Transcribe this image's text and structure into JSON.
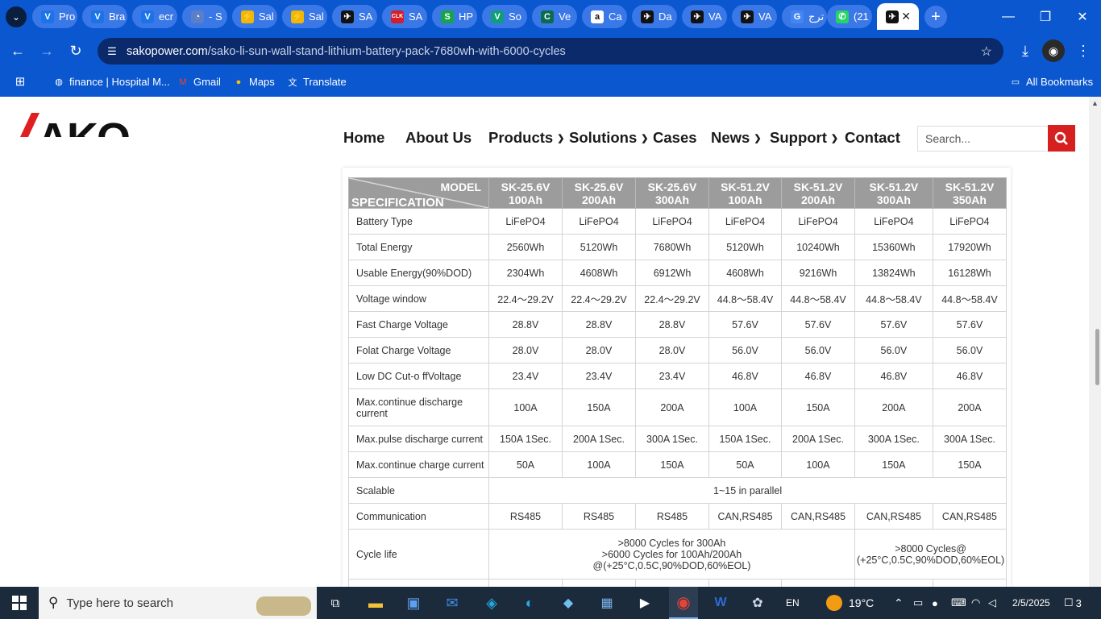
{
  "browser": {
    "tabs": [
      {
        "label": "Pro",
        "fav": "V",
        "favbg": "#1a73e8"
      },
      {
        "label": "Bra",
        "fav": "V",
        "favbg": "#1a73e8"
      },
      {
        "label": "ecr",
        "fav": "V",
        "favbg": "#1a73e8"
      },
      {
        "label": "- S",
        "fav": "◔",
        "favbg": "#5b7fc7"
      },
      {
        "label": "Sal",
        "fav": "⚡",
        "favbg": "#f2b705"
      },
      {
        "label": "Sal",
        "fav": "⚡",
        "favbg": "#f2b705"
      },
      {
        "label": "SA",
        "fav": "✈",
        "favbg": "#111111"
      },
      {
        "label": "SA",
        "fav": "CLK",
        "favbg": "#d21f2b"
      },
      {
        "label": "HP",
        "fav": "S",
        "favbg": "#16a34a"
      },
      {
        "label": "So",
        "fav": "V",
        "favbg": "#0f9d7a"
      },
      {
        "label": "Ve",
        "fav": "C",
        "favbg": "#0b6b4f"
      },
      {
        "label": "Ca",
        "fav": "a",
        "favbg": "#ffffff"
      },
      {
        "label": "Da",
        "fav": "✈",
        "favbg": "#111111"
      },
      {
        "label": "VA",
        "fav": "✈",
        "favbg": "#111111"
      },
      {
        "label": "VA",
        "fav": "✈",
        "favbg": "#111111"
      },
      {
        "label": "ترج",
        "fav": "G",
        "favbg": "#4285f4"
      },
      {
        "label": "(21",
        "fav": "✆",
        "favbg": "#25d366"
      }
    ],
    "active_tab": {
      "fav": "✈"
    },
    "url_domain": "sakopower.com",
    "url_path": "/sako-li-sun-wall-stand-lithium-battery-pack-7680wh-with-6000-cycles",
    "bookmarks": [
      "finance | Hospital M...",
      "Gmail",
      "Maps",
      "Translate"
    ],
    "all_bookmarks": "All Bookmarks"
  },
  "site": {
    "logo": "AKO",
    "nav": [
      "Home",
      "About Us",
      "Products",
      "Solutions",
      "Cases",
      "News",
      "Support",
      "Contact"
    ],
    "search_placeholder": "Search..."
  },
  "spec_table": {
    "corner_top": "MODEL",
    "corner_bottom": "SPECIFICATION",
    "models": [
      [
        "SK-25.6V",
        "100Ah"
      ],
      [
        "SK-25.6V",
        "200Ah"
      ],
      [
        "SK-25.6V",
        "300Ah"
      ],
      [
        "SK-51.2V",
        "100Ah"
      ],
      [
        "SK-51.2V",
        "200Ah"
      ],
      [
        "SK-51.2V",
        "300Ah"
      ],
      [
        "SK-51.2V",
        "350Ah"
      ]
    ],
    "rows": [
      {
        "label": "Battery Type",
        "cells": [
          "LiFePO4",
          "LiFePO4",
          "LiFePO4",
          "LiFePO4",
          "LiFePO4",
          "LiFePO4",
          "LiFePO4"
        ]
      },
      {
        "label": "Total Energy",
        "cells": [
          "2560Wh",
          "5120Wh",
          "7680Wh",
          "5120Wh",
          "10240Wh",
          "15360Wh",
          "17920Wh"
        ]
      },
      {
        "label": "Usable Energy(90%DOD)",
        "cells": [
          "2304Wh",
          "4608Wh",
          "6912Wh",
          "4608Wh",
          "9216Wh",
          "13824Wh",
          "16128Wh"
        ]
      },
      {
        "label": "Voltage window",
        "cells": [
          "22.4～29.2V",
          "22.4～29.2V",
          "22.4～29.2V",
          "44.8～58.4V",
          "44.8～58.4V",
          "44.8～58.4V",
          "44.8～58.4V"
        ]
      },
      {
        "label": "Fast Charge Voltage",
        "cells": [
          "28.8V",
          "28.8V",
          "28.8V",
          "57.6V",
          "57.6V",
          "57.6V",
          "57.6V"
        ]
      },
      {
        "label": "Folat Charge Voltage",
        "cells": [
          "28.0V",
          "28.0V",
          "28.0V",
          "56.0V",
          "56.0V",
          "56.0V",
          "56.0V"
        ]
      },
      {
        "label": "Low DC Cut-o ffVoltage",
        "cells": [
          "23.4V",
          "23.4V",
          "23.4V",
          "46.8V",
          "46.8V",
          "46.8V",
          "46.8V"
        ]
      },
      {
        "label": "Max.continue discharge current",
        "cells": [
          "100A",
          "150A",
          "200A",
          "100A",
          "150A",
          "200A",
          "200A"
        ]
      },
      {
        "label": "Max.pulse discharge current",
        "cells": [
          "150A 1Sec.",
          "200A 1Sec.",
          "300A 1Sec.",
          "150A 1Sec.",
          "200A 1Sec.",
          "300A 1Sec.",
          "300A 1Sec."
        ]
      },
      {
        "label": "Max.continue charge current",
        "cells": [
          "50A",
          "100A",
          "150A",
          "50A",
          "100A",
          "150A",
          "150A"
        ]
      }
    ],
    "scalable_label": "Scalable",
    "scalable_value": "1~15 in parallel",
    "communication_label": "Communication",
    "communication": [
      "RS485",
      "RS485",
      "RS485",
      "CAN,RS485",
      "CAN,RS485",
      "CAN,RS485",
      "CAN,RS485"
    ],
    "cycle_label": "Cycle life",
    "cycle_a": [
      ">8000 Cycles for 300Ah",
      ">6000 Cycles for 100Ah/200Ah",
      "@(+25°C,0.5C,90%DOD,60%EOL)"
    ],
    "cycle_b": [
      ">8000 Cycles@",
      "(+25°C,0.5C,90%DOD,60%EOL)"
    ]
  },
  "taskbar": {
    "search_placeholder": "Type here to search",
    "lang": "EN",
    "weather": "19°C",
    "date": "2/5/2025",
    "notifications": "3"
  }
}
